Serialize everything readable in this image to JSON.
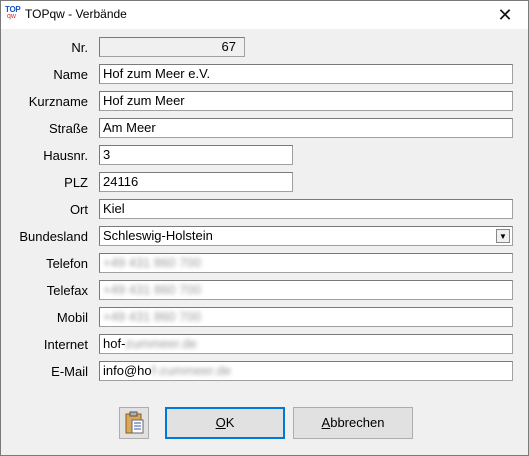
{
  "window": {
    "title": "TOPqw - Verbände",
    "icon": "topqw-app-icon",
    "close_glyph": "✕"
  },
  "form": {
    "nr": {
      "label": "Nr.",
      "value": "67"
    },
    "name": {
      "label": "Name",
      "value": "Hof zum Meer  e.V."
    },
    "kurzname": {
      "label": "Kurzname",
      "value": "Hof zum Meer"
    },
    "strasse": {
      "label": "Straße",
      "value": "Am Meer"
    },
    "hausnr": {
      "label": "Hausnr.",
      "value": "3"
    },
    "plz": {
      "label": "PLZ",
      "value": "24116"
    },
    "ort": {
      "label": "Ort",
      "value": "Kiel"
    },
    "bundesland": {
      "label": "Bundesland",
      "value": "Schleswig-Holstein"
    },
    "telefon": {
      "label": "Telefon",
      "value": ""
    },
    "telefax": {
      "label": "Telefax",
      "value": ""
    },
    "mobil": {
      "label": "Mobil",
      "value": ""
    },
    "internet": {
      "label": "Internet",
      "value": "hof-"
    },
    "email": {
      "label": "E-Mail",
      "value": "info@ho"
    }
  },
  "buttons": {
    "ok_prefix": "",
    "ok_mnemonic": "O",
    "ok_rest": "K",
    "cancel_mnemonic": "A",
    "cancel_rest": "bbrechen",
    "clipboard_icon": "clipboard-icon"
  }
}
